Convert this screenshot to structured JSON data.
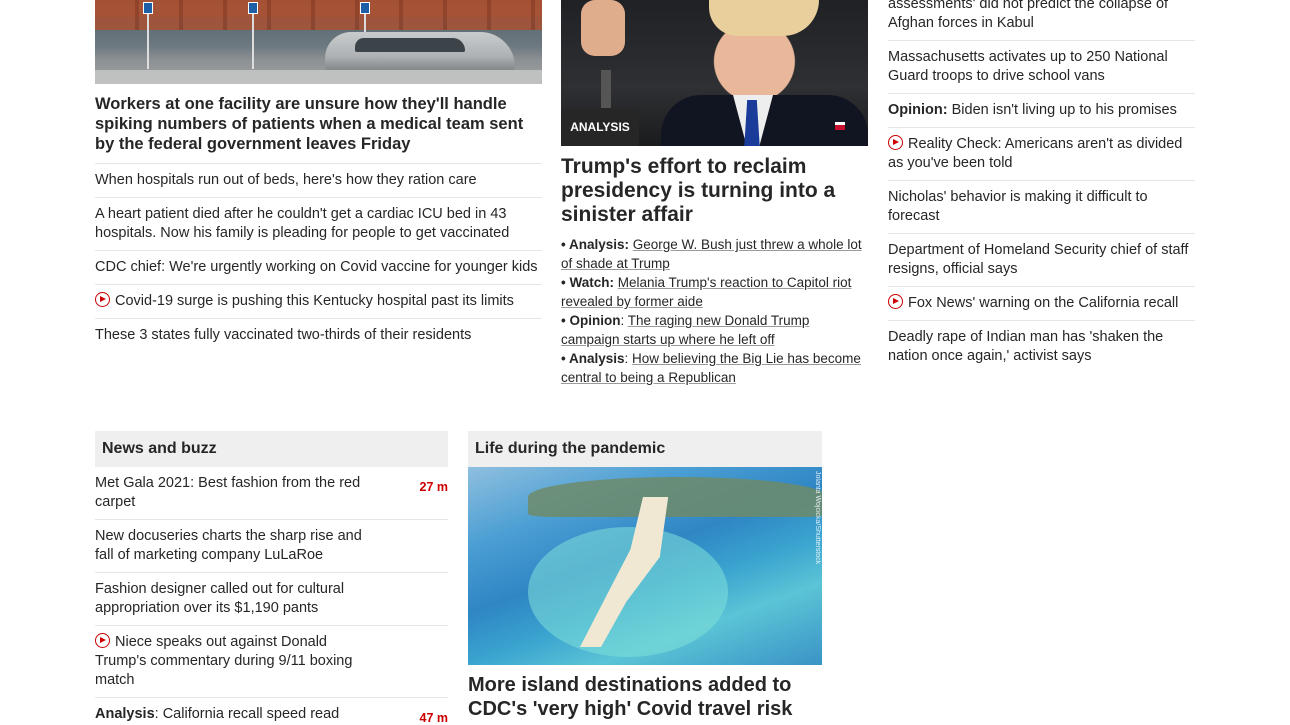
{
  "col1": {
    "hero_headline": "Workers at one facility are unsure how they'll handle spiking numbers of patients when a medical team sent by the federal government leaves Friday",
    "links": [
      {
        "text": "When hospitals run out of beds, here's how they ration care",
        "video": false
      },
      {
        "text": "A heart patient died after he couldn't get a cardiac ICU bed in 43 hospitals. Now his family is pleading for people to get vaccinated",
        "video": false
      },
      {
        "text": "CDC chief: We're urgently working on Covid vaccine for younger kids",
        "video": false
      },
      {
        "text": "Covid-19 surge is pushing this Kentucky hospital past its limits",
        "video": true
      },
      {
        "text": "These 3 states fully vaccinated two-thirds of their residents",
        "video": false
      }
    ]
  },
  "col2": {
    "badge": "ANALYSIS",
    "hero_headline": "Trump's effort to reclaim presidency is turning into a sinister affair",
    "bullets": [
      {
        "kicker": "Analysis:",
        "sep": " ",
        "text": "George W. Bush just threw a whole lot of shade at Trump"
      },
      {
        "kicker": "Watch:",
        "sep": " ",
        "text": "Melania Trump's reaction to Capitol riot revealed by former aide"
      },
      {
        "kicker": "Opinion",
        "sep": ": ",
        "text": "The raging new Donald Trump campaign starts up where he left off"
      },
      {
        "kicker": "Analysis",
        "sep": ": ",
        "text": "How believing the Big Lie has become central to being a Republican"
      }
    ]
  },
  "col3": {
    "top_partial": "assessments' did not predict the collapse of Afghan forces in Kabul",
    "links": [
      {
        "kicker": "",
        "text": "Massachusetts activates up to 250 National Guard troops to drive school vans",
        "video": false
      },
      {
        "kicker": "Opinion:",
        "text": " Biden isn't living up to his promises",
        "video": false
      },
      {
        "kicker": "",
        "text": "Reality Check: Americans aren't as divided as you've been told",
        "video": true
      },
      {
        "kicker": "",
        "text": "Nicholas' behavior is making it difficult to forecast",
        "video": false
      },
      {
        "kicker": "",
        "text": "Department of Homeland Security chief of staff resigns, official says",
        "video": false
      },
      {
        "kicker": "",
        "text": "Fox News' warning on the California recall",
        "video": true
      },
      {
        "kicker": "",
        "text": "Deadly rape of Indian man has 'shaken the nation once again,' activist says",
        "video": false
      }
    ]
  },
  "news": {
    "title": "News and buzz",
    "items": [
      {
        "kicker": "",
        "text": "Met Gala 2021: Best fashion from the red carpet",
        "time": "27 m",
        "video": false
      },
      {
        "kicker": "",
        "text": "New docuseries charts the sharp rise and fall of marketing company LuLaRoe",
        "time": "",
        "video": false
      },
      {
        "kicker": "",
        "text": "Fashion designer called out for cultural appropriation over its $1,190 pants",
        "time": "",
        "video": false
      },
      {
        "kicker": "",
        "text": "Niece speaks out against Donald Trump's commentary during 9/11 boxing match",
        "time": "",
        "video": true
      },
      {
        "kicker": "Analysis",
        "text": ": California recall speed read",
        "time": "47 m",
        "video": false
      }
    ]
  },
  "life": {
    "title": "Life during the pandemic",
    "photo_credit": "Jolanta Wojcicka/Shutterstock",
    "headline": "More island destinations added to CDC's 'very high' Covid travel risk"
  },
  "colors": {
    "accent": "#cc0000",
    "text": "#262626",
    "divider": "#e6e6e6",
    "section_bg": "#efefef"
  }
}
